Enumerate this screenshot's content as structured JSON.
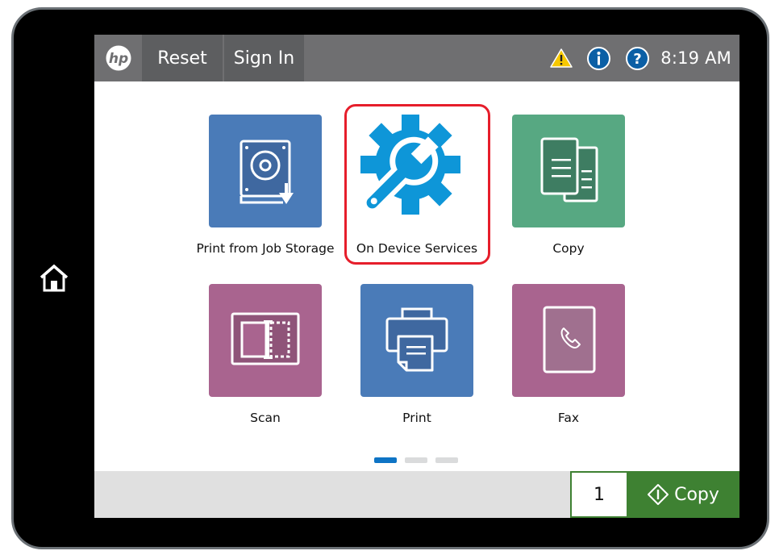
{
  "header": {
    "logo": "hp",
    "reset_label": "Reset",
    "signin_label": "Sign In",
    "status_icons": [
      "warning-icon",
      "info-icon",
      "help-icon"
    ],
    "time": "8:19 AM"
  },
  "tiles": [
    {
      "label": "Print from Job Storage",
      "icon": "job-storage-icon",
      "color": "#4a7bb8"
    },
    {
      "label": "On Device Services",
      "icon": "gear-wrench-icon",
      "color": "#0e96d8",
      "highlighted": true
    },
    {
      "label": "Copy",
      "icon": "copy-icon",
      "color": "#57a882"
    },
    {
      "label": "Scan",
      "icon": "scan-icon",
      "color": "#a9648f"
    },
    {
      "label": "Print",
      "icon": "printer-icon",
      "color": "#4a7bb8"
    },
    {
      "label": "Fax",
      "icon": "fax-icon",
      "color": "#a9648f"
    }
  ],
  "pager": {
    "pages": 3,
    "current": 1
  },
  "footer": {
    "copies_value": "1",
    "copy_button_label": "Copy"
  },
  "colors": {
    "header_bg": "#6f6f71",
    "accent_green": "#3e8132",
    "highlight_red": "#e61e2b",
    "pager_active": "#0e74c5"
  }
}
